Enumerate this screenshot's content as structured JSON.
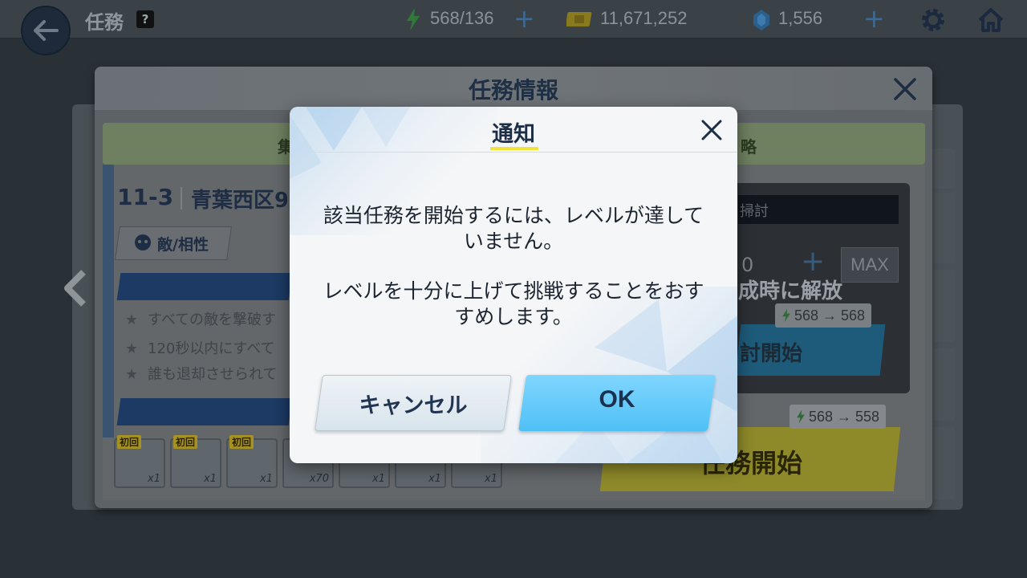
{
  "topbar": {
    "title": "任務",
    "help_label": "?",
    "ap": "568/136",
    "credits": "11,671,252",
    "gems": "1,556",
    "plus": "+"
  },
  "mission_panel": {
    "title": "任務情報",
    "tab_left": "集",
    "tab_right": "略",
    "stage_number": "11-3",
    "stage_name": "青葉西区9",
    "enemy_button": "敵/相性",
    "conditions": [
      "すべての敵を撃破す",
      "120秒以内にすべて",
      "誰も退却させられて"
    ],
    "rewards": [
      {
        "badge": "初回",
        "count": "x1"
      },
      {
        "badge": "初回",
        "count": "x1"
      },
      {
        "badge": "初回",
        "count": "x1"
      },
      {
        "badge": "",
        "count": "x70"
      },
      {
        "badge": "",
        "count": "x1"
      },
      {
        "badge": "",
        "count": "x1"
      },
      {
        "badge": "",
        "count": "x1"
      }
    ],
    "sweep_label": "掃討",
    "quantity": "0",
    "plus": "+",
    "max_label": "MAX",
    "unlock_text": "成時に解放",
    "sweep_energy": "568 → 568",
    "sweep_button": "討開始",
    "start_energy": "568 → 558",
    "start_button": "任務開始"
  },
  "notice": {
    "title": "通知",
    "message_line1": "該当任務を開始するには、レベルが達して",
    "message_line2": "いません。",
    "message_line3": "レベルを十分に上げて挑戦することをおす",
    "message_line4": "すめします。",
    "cancel_label": "キャンセル",
    "ok_label": "OK"
  }
}
